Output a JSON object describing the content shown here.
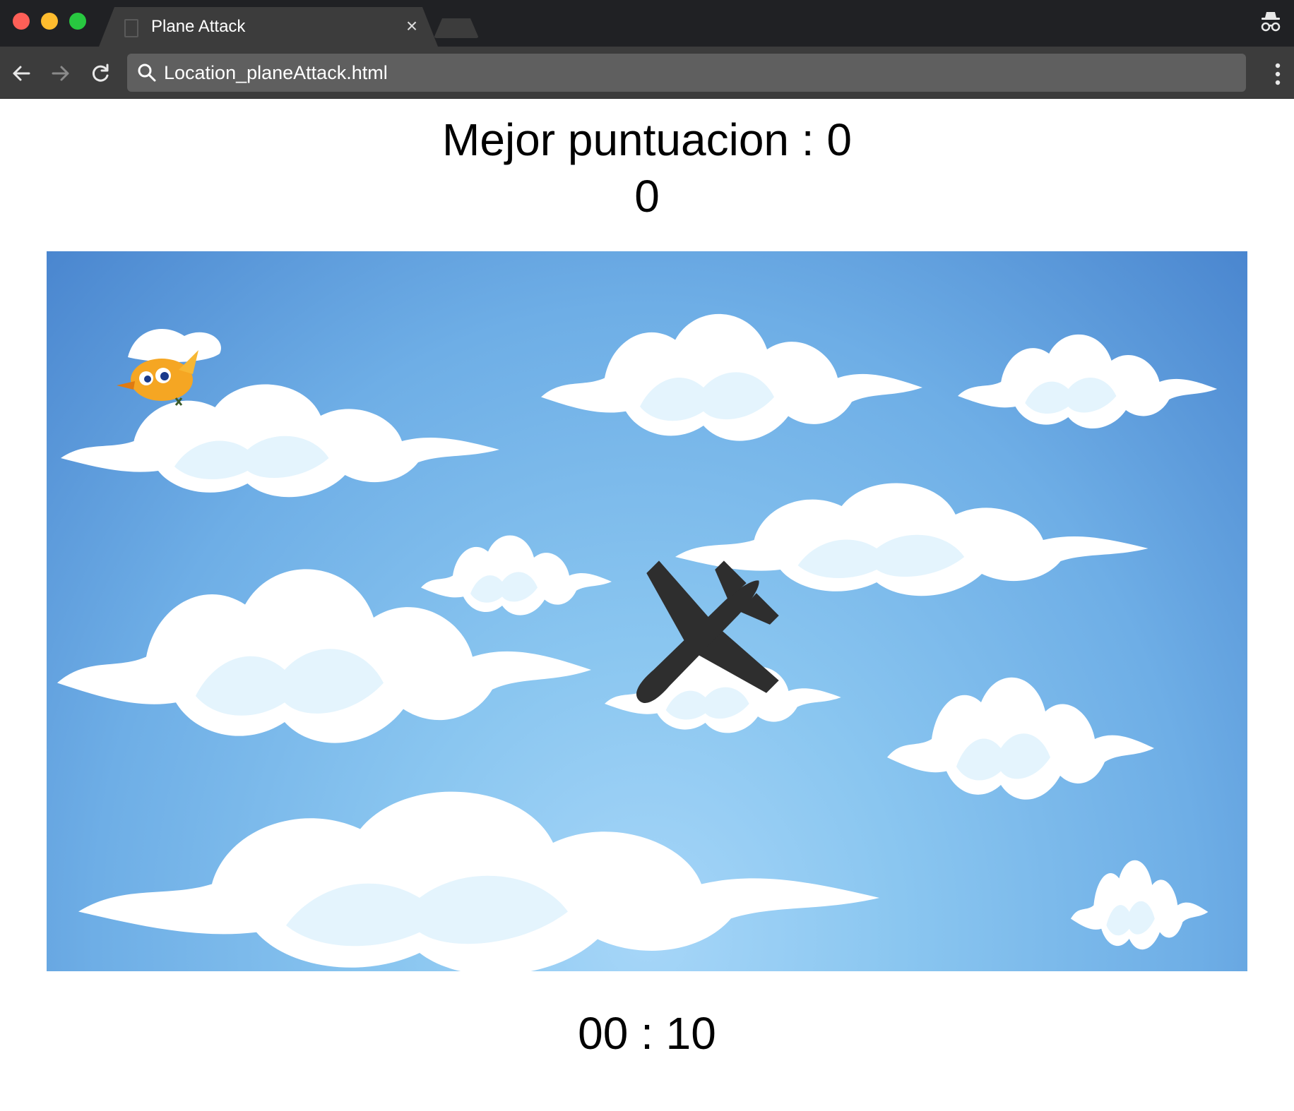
{
  "browser": {
    "tab_title": "Plane Attack",
    "tab_close_glyph": "×",
    "url": "Location_planeAttack.html",
    "icons": {
      "back": "arrow-left-icon",
      "forward": "arrow-right-icon",
      "reload": "reload-icon",
      "search": "search-icon",
      "menu": "vertical-dots-icon",
      "incognito": "incognito-icon"
    },
    "traffic_colors": {
      "close": "#fe5f57",
      "minimize": "#febc2e",
      "zoom": "#28c840"
    }
  },
  "game": {
    "best_score_text": "Mejor puntuacion : 0",
    "current_score": "0",
    "timer": "00 : 10",
    "sprites": {
      "player": "airplane-icon",
      "enemy": "bird-icon"
    },
    "colors": {
      "sky_top": "#4a86cf",
      "sky_bottom": "#a6d6f8",
      "cloud": "#ffffff",
      "cloud_shade": "#e4f4fd",
      "plane": "#2e2e2e",
      "bird": "#f5a623"
    }
  }
}
